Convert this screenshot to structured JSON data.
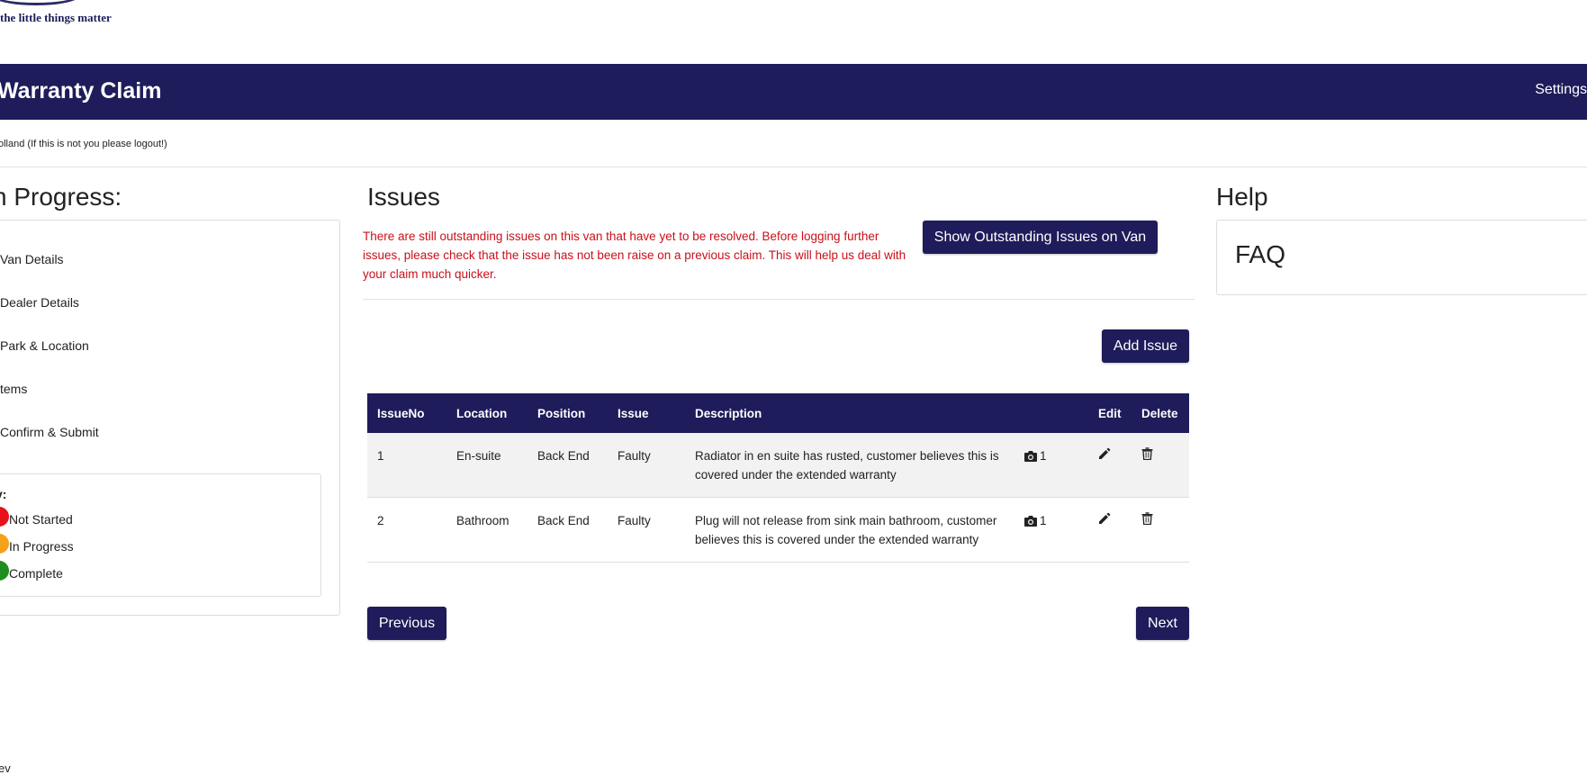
{
  "brand": {
    "tagline": "the little things matter"
  },
  "header": {
    "title": "Warranty Claim",
    "settings_label": "Settings"
  },
  "user": {
    "notice": "olland (If this is not you please logout!)"
  },
  "progress": {
    "title": "n Progress:",
    "steps": [
      {
        "label": "Van Details"
      },
      {
        "label": "Dealer Details"
      },
      {
        "label": "Park & Location"
      },
      {
        "label": "tems"
      },
      {
        "label": "Confirm & Submit"
      }
    ],
    "key": {
      "title": "y:",
      "items": [
        {
          "label": "Not Started",
          "color": "#e8101a"
        },
        {
          "label": "In Progress",
          "color": "#f5a11a"
        },
        {
          "label": "Complete",
          "color": "#1e8f1e"
        }
      ]
    }
  },
  "issues": {
    "title": "Issues",
    "warning": "There are still outstanding issues on this van that have yet to be resolved. Before logging further issues, please check that the issue has not been raise on a previous claim. This will help us deal with your claim much quicker.",
    "show_outstanding_label": "Show Outstanding Issues on Van",
    "add_issue_label": "Add Issue",
    "columns": [
      "IssueNo",
      "Location",
      "Position",
      "Issue",
      "Description",
      "",
      "Edit",
      "Delete"
    ],
    "rows": [
      {
        "issue_no": "1",
        "location": "En-suite",
        "position": "Back End",
        "issue": "Faulty",
        "description": "Radiator in en suite has rusted, customer believes this is covered under the extended warranty",
        "photo_count": "1"
      },
      {
        "issue_no": "2",
        "location": "Bathroom",
        "position": "Back End",
        "issue": "Faulty",
        "description": "Plug will not release from sink main bathroom, customer believes this is covered under the extended warranty",
        "photo_count": "1"
      }
    ],
    "previous_label": "Previous",
    "next_label": "Next"
  },
  "help": {
    "title": "Help",
    "faq_title": "FAQ"
  },
  "footer": {
    "text": "ev"
  },
  "colors": {
    "brand_navy": "#1e1c5a",
    "warning_red": "#c8101a",
    "row_stripe": "#f2f2f2"
  },
  "icons": {
    "photo": "camera-icon",
    "edit": "pencil-icon",
    "delete": "trash-icon"
  }
}
